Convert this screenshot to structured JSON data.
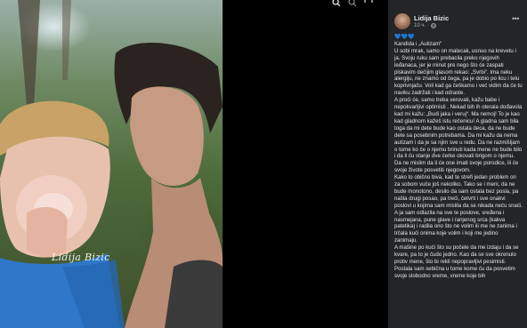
{
  "viewer": {
    "watermark": "Lidija Bizic",
    "icons": [
      "search-icon",
      "zoom-icon",
      "fullscreen-icon"
    ]
  },
  "post": {
    "author": "Lidija Bizic",
    "time": "10 ч.",
    "privacy_icon": "globe-icon",
    "more_icon": "more-options-icon",
    "hearts": "💙💙💙",
    "paragraphs": [
      "Kandida i „Autizam“",
      "U sobi mrak, samo on malecak, usnuo na krevetu i ja. Svoju ruku sam prebacila preko njegovih leđanaca, jer je minut pre nego što će zaspati piskavim dečijim glasom rekao: „Svrbi“. Ima neku alergiju, ne znamo od čega, pa je dobio po licu i telu koprivnjaču. Voli kad ga češkamo i već vidim da će tu naviku zadržati i kad odraste.",
      "A proći će, samo treba verovati, kažu babe i nepokvarljivi optimisti . Nekad bih ih oterala dođavola kad mi kažu: „Budi jaka i veruj“. Ma nemoj! To je kao kad gladnom kažeš istu rečenicu! A gladna sam bila toga da mi dete bude kao ostala deca, da ne bude dete sa posebnim potrebama. Da mi kažu da nema autizam i da je sa njim sve u redu. Da ne razmišljam o tome ko će o njemu brinuti kada mene ne bude bilo i da li ću stanje dve ćerke okovati brigom o njemu. Da ne mislim da li će one imati svoje porodice, ili će svoje živote posvetiti njegovom.",
      "Kako to obično biva, kad te strefi jedan problem on za sobom vuče još nekoliko. Tako se i meni, da ne bude monotono, desilo da sam ostala bez posla, pa našla drugi posao, pa treći, četvrti i sve onakvi poslovi u kojima sam mislila da se nikada neću snaći. A ja sam odlazila na sve te poslove, sređena i nasmejana, pune glave i ranjenog srca (kakva patetika) i radila ono što ne volim ili me ne zanima i trčala kući onima koje volim i koji me jedino zanimaju.",
      "A mašine po kući što su počele da me izdaju i da se kvare, pa to je čudo jedno. Kao da se sve okrenulo protiv mene, što bi rekli nepopravljivi pesimisti.",
      "Postala sam sebična u tome kome ću da posvetim svoje slobodno vreme, vreme koje bih"
    ]
  }
}
